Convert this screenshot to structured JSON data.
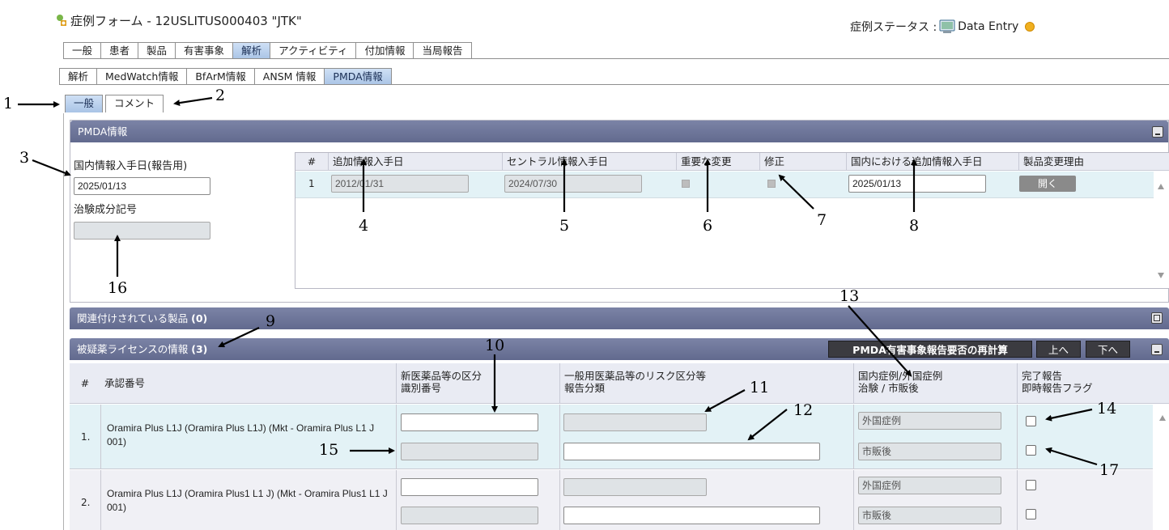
{
  "header": {
    "title": "症例フォーム - 12USLITUS000403 \"JTK\"",
    "status_label": "症例ステータス :",
    "status_value": "Data Entry"
  },
  "tabs_main": [
    "一般",
    "患者",
    "製品",
    "有害事象",
    "解析",
    "アクティビティ",
    "付加情報",
    "当局報告"
  ],
  "tabs_analysis": [
    "解析",
    "MedWatch情報",
    "BfArM情報",
    "ANSM 情報",
    "PMDA情報"
  ],
  "tabs_pmda": [
    "一般",
    "コメント"
  ],
  "pmda_panel": {
    "title": "PMDA情報",
    "domestic_date_label": "国内情報入手日(報告用)",
    "domestic_date_value": "2025/01/13",
    "trial_code_label": "治験成分記号",
    "trial_code_value": "",
    "grid": {
      "headers": [
        "#",
        "追加情報入手日",
        "セントラル情報入手日",
        "重要な変更",
        "修正",
        "国内における追加情報入手日",
        "製品変更理由"
      ],
      "rows": [
        {
          "num": "1",
          "additional_date": "2012/01/31",
          "central_date": "2024/07/30",
          "domestic_additional_date": "2025/01/13",
          "reason_button": "開く"
        }
      ]
    }
  },
  "related_products": {
    "label": "関連付けされている製品",
    "count": "(0)"
  },
  "license_panel": {
    "label": "被疑薬ライセンスの情報",
    "count": "(3)",
    "recalc_button": "PMDA有害事象報告要否の再計算",
    "up_button": "上へ",
    "down_button": "下へ",
    "headers": {
      "num": "#",
      "approval": "承認番号",
      "new_drug_1": "新医薬品等の区分",
      "new_drug_2": "識別番号",
      "risk_1": "一般用医薬品等のリスク区分等",
      "risk_2": "報告分類",
      "case_1": "国内症例/外国症例",
      "case_2": "治験 / 市販後",
      "report_1": "完了報告",
      "report_2": "即時報告フラグ"
    },
    "rows": [
      {
        "num": "1.",
        "name": "Oramira Plus L1J (Oramira Plus L1J) (Mkt - Oramira Plus L1 J 001)",
        "case_type": "外国症例",
        "phase": "市販後"
      },
      {
        "num": "2.",
        "name": "Oramira Plus L1J (Oramira Plus1 L1 J) (Mkt - Oramira Plus1 L1 J 001)",
        "case_type": "外国症例",
        "phase": "市販後"
      }
    ]
  },
  "callouts": [
    "1",
    "2",
    "3",
    "4",
    "5",
    "6",
    "7",
    "8",
    "9",
    "10",
    "11",
    "12",
    "13",
    "14",
    "15",
    "16",
    "17"
  ],
  "colors": {
    "panel_header": "#6e7699",
    "active_tab": "#b3cbea",
    "row_highlight": "#e3f2f6",
    "status_dot": "#f0b020"
  }
}
